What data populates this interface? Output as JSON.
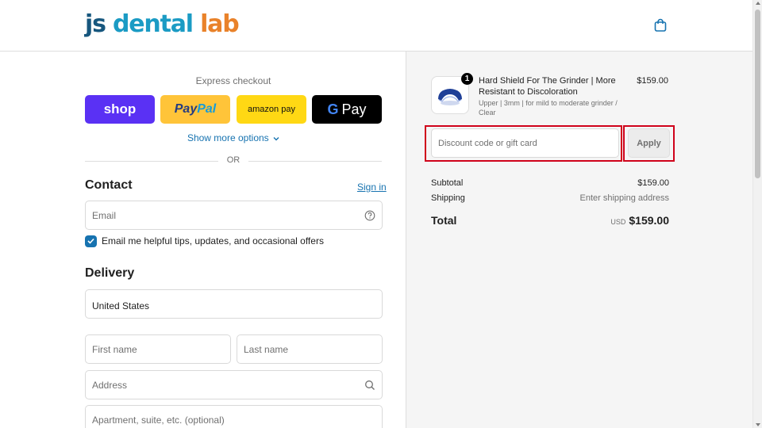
{
  "header": {
    "logo": {
      "part1": "js ",
      "part2": "dental ",
      "part3": "lab"
    },
    "cart_icon": "shopping-bag-icon"
  },
  "express": {
    "label": "Express checkout",
    "buttons": {
      "shop": "shop",
      "paypal_a": "Pay",
      "paypal_b": "Pal",
      "amazon": "amazon pay",
      "gpay_g": "G",
      "gpay_label": "Pay"
    },
    "show_more": "Show more options",
    "or": "OR"
  },
  "contact": {
    "title": "Contact",
    "sign_in": "Sign in",
    "email_placeholder": "Email",
    "email_help_icon": "question-circle-icon",
    "newsletter_label": "Email me helpful tips, updates, and occasional offers",
    "newsletter_checked": true
  },
  "delivery": {
    "title": "Delivery",
    "country_value": "United States",
    "first_name_placeholder": "First name",
    "last_name_placeholder": "Last name",
    "address_placeholder": "Address",
    "address_search_icon": "search-icon",
    "apartment_placeholder": "Apartment, suite, etc. (optional)"
  },
  "order": {
    "product": {
      "quantity": "1",
      "title": "Hard Shield For The Grinder | More Resistant to Discoloration",
      "variant": "Upper | 3mm | for mild to moderate grinder / Clear",
      "price": "$159.00"
    },
    "discount_placeholder": "Discount code or gift card",
    "apply_label": "Apply",
    "subtotal_label": "Subtotal",
    "subtotal_value": "$159.00",
    "shipping_label": "Shipping",
    "shipping_value": "Enter shipping address",
    "total_label": "Total",
    "total_currency": "USD",
    "total_value": "$159.00"
  },
  "colors": {
    "shop_purple": "#5a31f4",
    "paypal_yellow": "#ffc439",
    "amazon_yellow": "#ffd814",
    "link_blue": "#1773b0",
    "highlight_red": "#d0021b"
  }
}
